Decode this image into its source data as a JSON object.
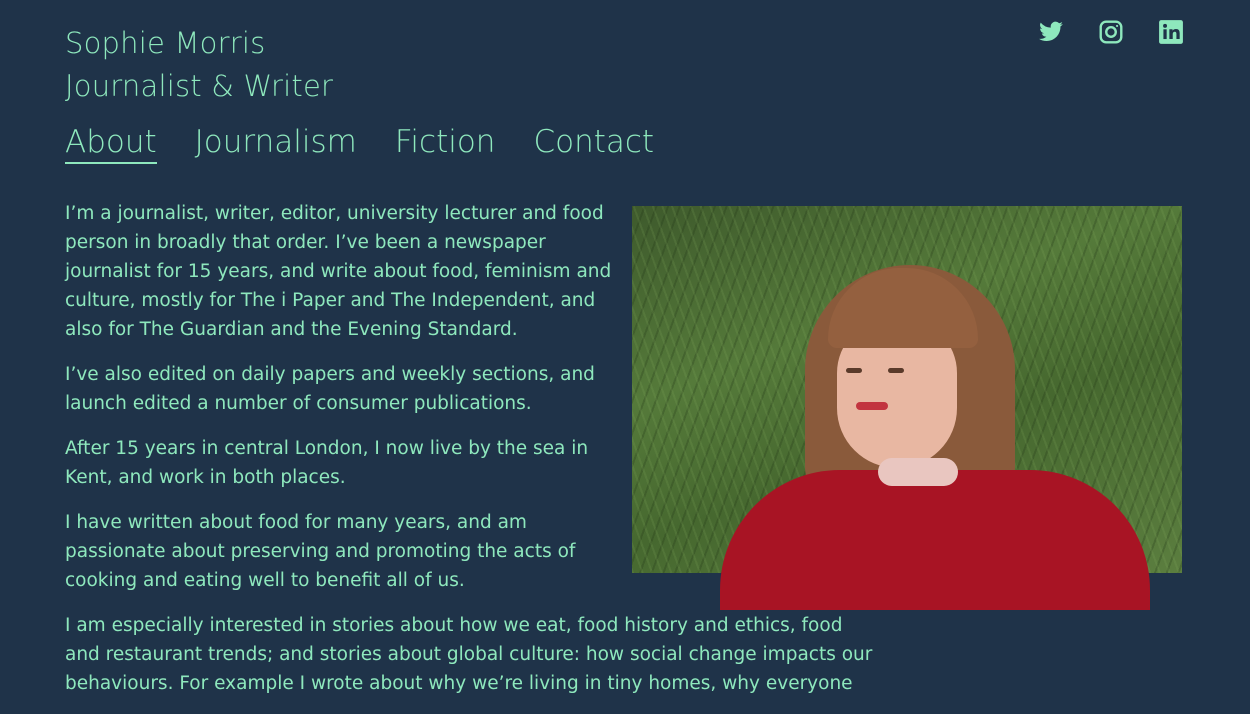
{
  "header": {
    "name": "Sophie Morris",
    "tagline": "Journalist & Writer"
  },
  "social": [
    {
      "icon": "twitter-icon"
    },
    {
      "icon": "instagram-icon"
    },
    {
      "icon": "linkedin-icon"
    }
  ],
  "nav": {
    "items": [
      "About",
      "Journalism",
      "Fiction",
      "Contact"
    ],
    "active": "About"
  },
  "colors": {
    "background": "#1f3349",
    "accent": "#8ee8bd"
  },
  "content": {
    "paragraphs": [
      "I’m a journalist, writer, editor, university lecturer and food person in broadly that order. I’ve been a newspaper journalist for 15 years, and write about food, feminism and culture, mostly for The i Paper and The Independent, and also for The Guardian and the Evening Standard.",
      "I’ve also edited on daily papers and weekly sections, and launch edited a number of consumer publications.",
      "After 15 years in central London, I now live by the sea in Kent, and work in both places.",
      "I have written about food for many years, and am passionate about preserving and promoting the acts of cooking and eating well to benefit all of us.",
      "I am especially interested in stories about how we eat, food history and ethics, food and restaurant trends; and stories about global culture: how social change impacts our behaviours. For example I wrote about why we’re living in tiny homes, why everyone"
    ]
  }
}
